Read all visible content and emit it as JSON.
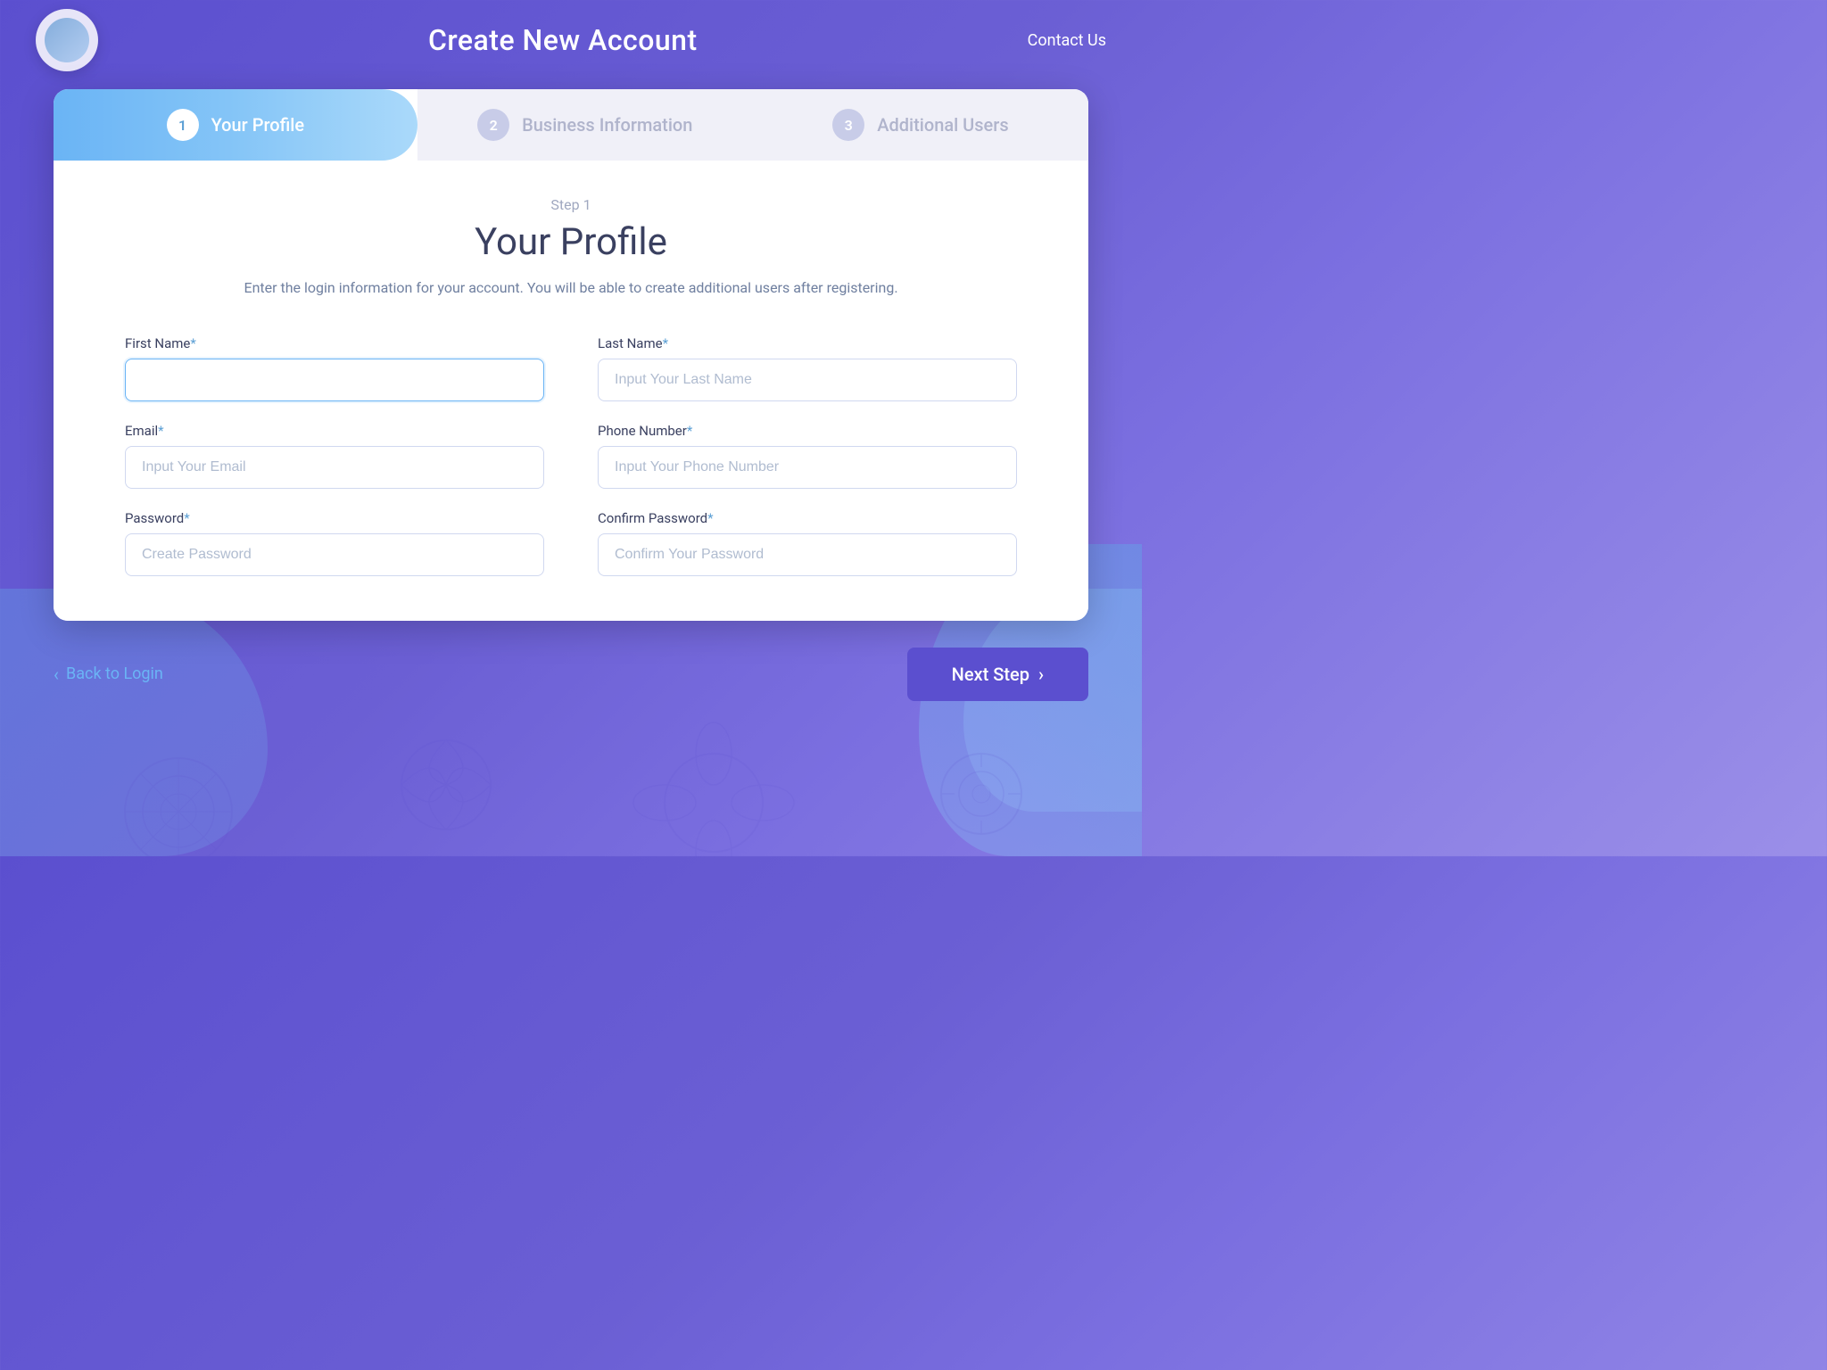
{
  "header": {
    "title": "Create New Account",
    "contact_us": "Contact Us"
  },
  "steps": [
    {
      "number": "1",
      "label": "Your Profile",
      "active": true
    },
    {
      "number": "2",
      "label": "Business Information",
      "active": false
    },
    {
      "number": "3",
      "label": "Additional Users",
      "active": false
    }
  ],
  "form": {
    "step_indicator": "Step 1",
    "title": "Your Profile",
    "description": "Enter the login information for your account. You will\nbe able to create additional users after registering.",
    "fields": {
      "first_name": {
        "label": "First Name",
        "required": "*",
        "placeholder": "",
        "value": ""
      },
      "last_name": {
        "label": "Last Name",
        "required": "*",
        "placeholder": "Input Your Last Name",
        "value": ""
      },
      "email": {
        "label": "Email",
        "required": "*",
        "placeholder": "Input Your Email",
        "value": ""
      },
      "phone": {
        "label": "Phone Number",
        "required": "*",
        "placeholder": "Input Your Phone Number",
        "value": ""
      },
      "password": {
        "label": "Password",
        "required": "*",
        "placeholder": "Create Password",
        "value": ""
      },
      "confirm_password": {
        "label": "Confirm Password",
        "required": "*",
        "placeholder": "Confirm Your Password",
        "value": ""
      }
    }
  },
  "buttons": {
    "back": "Back to Login",
    "next": "Next Step"
  }
}
